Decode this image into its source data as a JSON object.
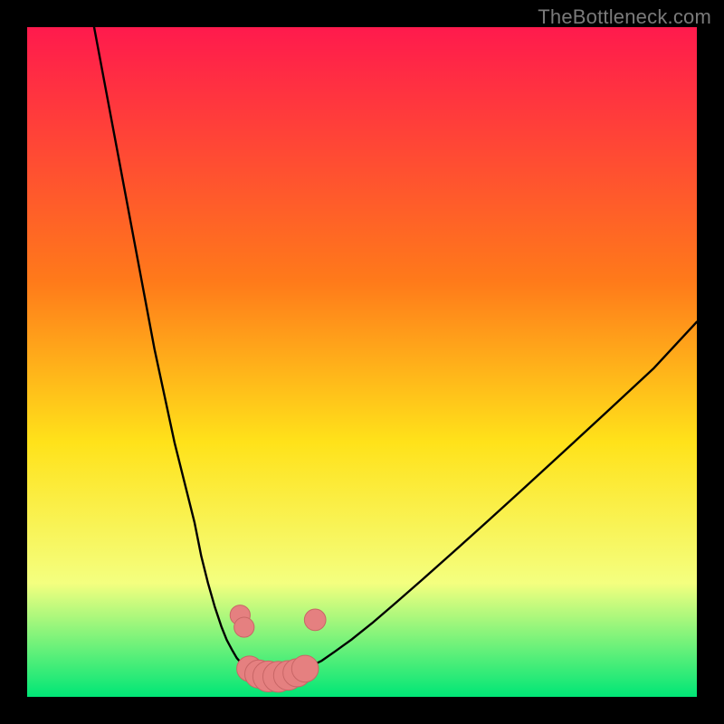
{
  "watermark": "TheBottleneck.com",
  "chart_data": {
    "type": "line",
    "title": "",
    "xlabel": "",
    "ylabel": "",
    "xlim": [
      0,
      100
    ],
    "ylim": [
      0,
      100
    ],
    "colors": {
      "gradient_top": "#ff1a4d",
      "gradient_mid1": "#ff7a1a",
      "gradient_mid2": "#ffe21a",
      "gradient_mid3": "#f4ff7f",
      "gradient_bottom": "#00e676",
      "curve": "#000000",
      "marker_fill": "#e58080",
      "marker_stroke": "#c86666"
    },
    "series": [
      {
        "name": "left-branch",
        "x": [
          10,
          11.5,
          13,
          14.5,
          16,
          17.5,
          19,
          20.5,
          22,
          23.5,
          25,
          26,
          27,
          28,
          29,
          29.8,
          30.6,
          31.3,
          32,
          32.6
        ],
        "y": [
          100,
          92,
          84,
          76,
          68,
          60,
          52,
          45,
          38,
          32,
          26,
          21,
          17,
          13.5,
          10.5,
          8.5,
          7,
          5.8,
          5,
          4.4
        ]
      },
      {
        "name": "valley",
        "x": [
          32.6,
          33.3,
          34,
          34.8,
          35.6,
          36.5,
          37.5,
          38.5,
          39.6,
          40.8,
          42
        ],
        "y": [
          4.4,
          3.9,
          3.5,
          3.2,
          3.05,
          3,
          3.05,
          3.2,
          3.5,
          3.9,
          4.4
        ]
      },
      {
        "name": "right-branch",
        "x": [
          42,
          44,
          46,
          48.5,
          51.5,
          55,
          59,
          63.5,
          68.5,
          74,
          80,
          86.5,
          93.5,
          100
        ],
        "y": [
          4.4,
          5.4,
          6.8,
          8.6,
          11,
          14,
          17.5,
          21.5,
          26,
          31,
          36.5,
          42.5,
          49,
          56
        ]
      }
    ],
    "markers": [
      {
        "x": 31.8,
        "y": 12.2,
        "r": 1.5
      },
      {
        "x": 32.4,
        "y": 10.4,
        "r": 1.5
      },
      {
        "x": 33.2,
        "y": 4.2,
        "r": 1.9
      },
      {
        "x": 34.6,
        "y": 3.4,
        "r": 2.1
      },
      {
        "x": 36.0,
        "y": 3.05,
        "r": 2.3
      },
      {
        "x": 37.5,
        "y": 3.0,
        "r": 2.3
      },
      {
        "x": 39.0,
        "y": 3.2,
        "r": 2.2
      },
      {
        "x": 40.3,
        "y": 3.6,
        "r": 2.1
      },
      {
        "x": 41.5,
        "y": 4.2,
        "r": 2.0
      },
      {
        "x": 43.0,
        "y": 11.5,
        "r": 1.6
      }
    ]
  }
}
